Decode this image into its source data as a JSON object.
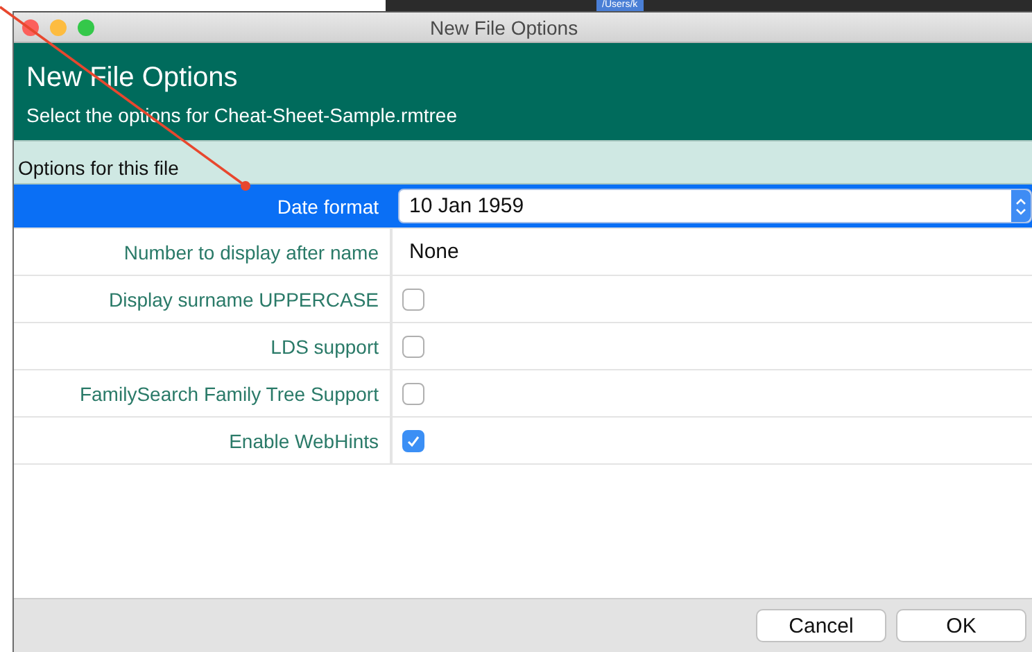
{
  "background": {
    "path_text": "/Users/k"
  },
  "window": {
    "title": "New File Options"
  },
  "header": {
    "title": "New File Options",
    "subtitle": "Select the options for Cheat-Sheet-Sample.rmtree"
  },
  "section": {
    "title": "Options for this file"
  },
  "rows": [
    {
      "label": "Date format",
      "kind": "select",
      "value": "10 Jan 1959",
      "selected": true
    },
    {
      "label": "Number to display after name",
      "kind": "text",
      "value": "None",
      "selected": false
    },
    {
      "label": "Display surname UPPERCASE",
      "kind": "checkbox",
      "checked": false,
      "selected": false
    },
    {
      "label": "LDS support",
      "kind": "checkbox",
      "checked": false,
      "selected": false
    },
    {
      "label": "FamilySearch Family Tree Support",
      "kind": "checkbox",
      "checked": false,
      "selected": false
    },
    {
      "label": "Enable WebHints",
      "kind": "checkbox",
      "checked": true,
      "selected": false
    }
  ],
  "buttons": [
    {
      "label": "Cancel"
    },
    {
      "label": "OK"
    }
  ]
}
